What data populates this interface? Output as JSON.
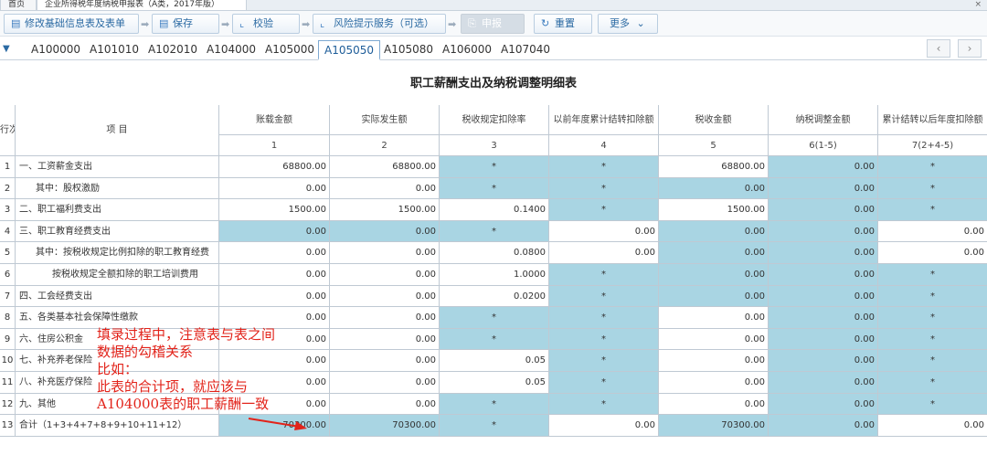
{
  "window_tabs": [
    {
      "label": "首页",
      "active": false
    },
    {
      "label": "企业所得税年度纳税申报表（A类，2017年版）",
      "active": true
    }
  ],
  "close_glyph": "×",
  "toolbar": {
    "buttons": [
      {
        "label": "修改基础信息表及表单",
        "icon": "edit-form-icon",
        "enabled": true
      },
      {
        "label": "保存",
        "icon": "save-icon",
        "enabled": true
      },
      {
        "label": "校验",
        "icon": "check-chart-icon",
        "enabled": true
      },
      {
        "label": "风险提示服务（可选）",
        "icon": "risk-chart-icon",
        "enabled": true
      },
      {
        "label": "申报",
        "icon": "submit-icon",
        "enabled": false
      },
      {
        "label": "重置",
        "icon": "refresh-icon",
        "enabled": true
      },
      {
        "label": "更多",
        "icon": "chevron-down-icon",
        "enabled": true
      }
    ]
  },
  "form_tabs": [
    "A100000",
    "A101010",
    "A102010",
    "A104000",
    "A105000",
    "A105050",
    "A105080",
    "A106000",
    "A107040"
  ],
  "active_form_tab": "A105050",
  "nav": {
    "prev": "‹",
    "next": "›"
  },
  "table": {
    "title": "职工薪酬支出及纳税调整明细表",
    "header": {
      "row_no": "行次",
      "item": "项 目",
      "columns": [
        {
          "name": "账载金额",
          "num": "1"
        },
        {
          "name": "实际发生额",
          "num": "2"
        },
        {
          "name": "税收规定扣除率",
          "num": "3"
        },
        {
          "name": "以前年度累计结转扣除额",
          "num": "4"
        },
        {
          "name": "税收金额",
          "num": "5"
        },
        {
          "name": "纳税调整金额",
          "num": "6(1-5)"
        },
        {
          "name": "累计结转以后年度扣除额",
          "num": "7(2+4-5)"
        }
      ]
    },
    "rows": [
      {
        "no": "1",
        "item": "一、工资薪金支出",
        "indent": 0,
        "v": [
          "68800.00",
          "68800.00",
          "*",
          "*",
          "68800.00",
          "0.00",
          "*"
        ]
      },
      {
        "no": "2",
        "item": "其中：股权激励",
        "indent": 1,
        "v": [
          "0.00",
          "0.00",
          "*",
          "*",
          "0.00",
          "0.00",
          "*"
        ]
      },
      {
        "no": "3",
        "item": "二、职工福利费支出",
        "indent": 0,
        "v": [
          "1500.00",
          "1500.00",
          "0.1400",
          "*",
          "1500.00",
          "0.00",
          "*"
        ]
      },
      {
        "no": "4",
        "item": "三、职工教育经费支出",
        "indent": 0,
        "v": [
          "0.00",
          "0.00",
          "*",
          "0.00",
          "0.00",
          "0.00",
          "0.00"
        ]
      },
      {
        "no": "5",
        "item": "其中：按税收规定比例扣除的职工教育经费",
        "indent": 1,
        "v": [
          "0.00",
          "0.00",
          "0.0800",
          "0.00",
          "0.00",
          "0.00",
          "0.00"
        ]
      },
      {
        "no": "6",
        "item": "按税收规定全额扣除的职工培训费用",
        "indent": 2,
        "v": [
          "0.00",
          "0.00",
          "1.0000",
          "*",
          "0.00",
          "0.00",
          "*"
        ]
      },
      {
        "no": "7",
        "item": "四、工会经费支出",
        "indent": 0,
        "v": [
          "0.00",
          "0.00",
          "0.0200",
          "*",
          "0.00",
          "0.00",
          "*"
        ]
      },
      {
        "no": "8",
        "item": "五、各类基本社会保障性缴款",
        "indent": 0,
        "v": [
          "0.00",
          "0.00",
          "*",
          "*",
          "0.00",
          "0.00",
          "*"
        ]
      },
      {
        "no": "9",
        "item": "六、住房公积金",
        "indent": 0,
        "v": [
          "0.00",
          "0.00",
          "*",
          "*",
          "0.00",
          "0.00",
          "*"
        ]
      },
      {
        "no": "10",
        "item": "七、补充养老保险",
        "indent": 0,
        "v": [
          "0.00",
          "0.00",
          "0.05",
          "*",
          "0.00",
          "0.00",
          "*"
        ]
      },
      {
        "no": "11",
        "item": "八、补充医疗保险",
        "indent": 0,
        "v": [
          "0.00",
          "0.00",
          "0.05",
          "*",
          "0.00",
          "0.00",
          "*"
        ]
      },
      {
        "no": "12",
        "item": "九、其他",
        "indent": 0,
        "v": [
          "0.00",
          "0.00",
          "*",
          "*",
          "0.00",
          "0.00",
          "*"
        ]
      },
      {
        "no": "13",
        "item": "合计（1+3+4+7+8+9+10+11+12）",
        "indent": 0,
        "v": [
          "70300.00",
          "70300.00",
          "*",
          "0.00",
          "70300.00",
          "0.00",
          "0.00"
        ]
      }
    ],
    "blue_map": [
      [
        0,
        0,
        1,
        1,
        0,
        1,
        1
      ],
      [
        0,
        0,
        1,
        1,
        1,
        1,
        1
      ],
      [
        0,
        0,
        0,
        1,
        0,
        1,
        1
      ],
      [
        1,
        1,
        1,
        0,
        1,
        1,
        0
      ],
      [
        0,
        0,
        0,
        0,
        1,
        1,
        0
      ],
      [
        0,
        0,
        0,
        1,
        1,
        1,
        1
      ],
      [
        0,
        0,
        0,
        1,
        1,
        1,
        1
      ],
      [
        0,
        0,
        1,
        1,
        0,
        1,
        1
      ],
      [
        0,
        0,
        1,
        1,
        0,
        1,
        1
      ],
      [
        0,
        0,
        0,
        1,
        0,
        1,
        1
      ],
      [
        0,
        0,
        0,
        1,
        0,
        1,
        1
      ],
      [
        0,
        0,
        1,
        1,
        0,
        1,
        1
      ],
      [
        1,
        1,
        1,
        0,
        1,
        1,
        0
      ]
    ]
  },
  "annotation": {
    "lines": [
      "填录过程中，注意表与表之间",
      "数据的勾稽关系",
      "比如：",
      "此表的合计项，就应该与",
      "A104000表的职工薪酬一致"
    ],
    "color": "#e2231a"
  }
}
